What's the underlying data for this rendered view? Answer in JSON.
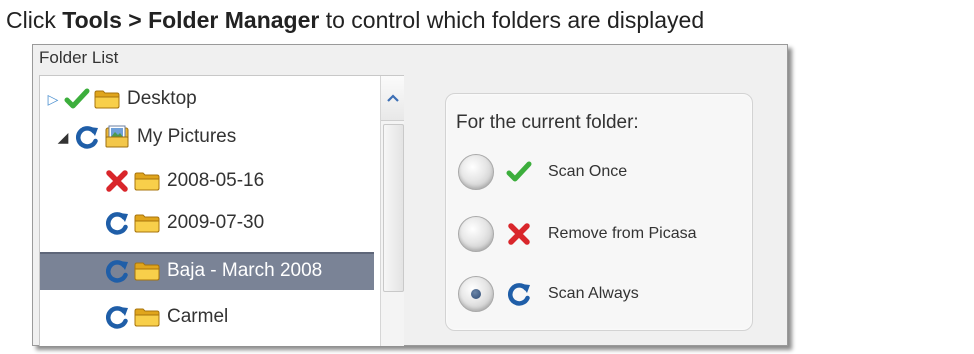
{
  "instruction": {
    "prefix": "Click ",
    "bold": "Tools > Folder Manager",
    "suffix": " to control which folders are displayed"
  },
  "panel": {
    "title": "Folder List"
  },
  "tree": {
    "nodes": [
      {
        "label": "Desktop",
        "status_icon": "checkmark-icon",
        "folder_icon": "folder-icon",
        "expander": "collapsed"
      },
      {
        "label": "My Pictures",
        "status_icon": "refresh-icon",
        "folder_icon": "pictures-folder-icon",
        "expander": "expanded"
      },
      {
        "label": "2008-05-16",
        "status_icon": "red-x-icon",
        "folder_icon": "folder-icon"
      },
      {
        "label": "2009-07-30",
        "status_icon": "refresh-icon",
        "folder_icon": "folder-icon"
      },
      {
        "label": "Baja - March 2008",
        "status_icon": "refresh-icon",
        "folder_icon": "folder-icon",
        "selected": true
      },
      {
        "label": "Carmel",
        "status_icon": "refresh-icon",
        "folder_icon": "folder-icon"
      }
    ]
  },
  "options": {
    "title": "For the current folder:",
    "items": [
      {
        "label": "Scan Once",
        "icon": "checkmark-icon",
        "selected": false
      },
      {
        "label": "Remove from Picasa",
        "icon": "red-x-icon",
        "selected": false
      },
      {
        "label": "Scan Always",
        "icon": "refresh-icon",
        "selected": true
      }
    ]
  },
  "colors": {
    "selected_row": "#7a8396",
    "check_green": "#3cae3c",
    "x_red": "#d9262b",
    "refresh_blue": "#1f5ea8",
    "folder_yellow": "#f4c430"
  }
}
